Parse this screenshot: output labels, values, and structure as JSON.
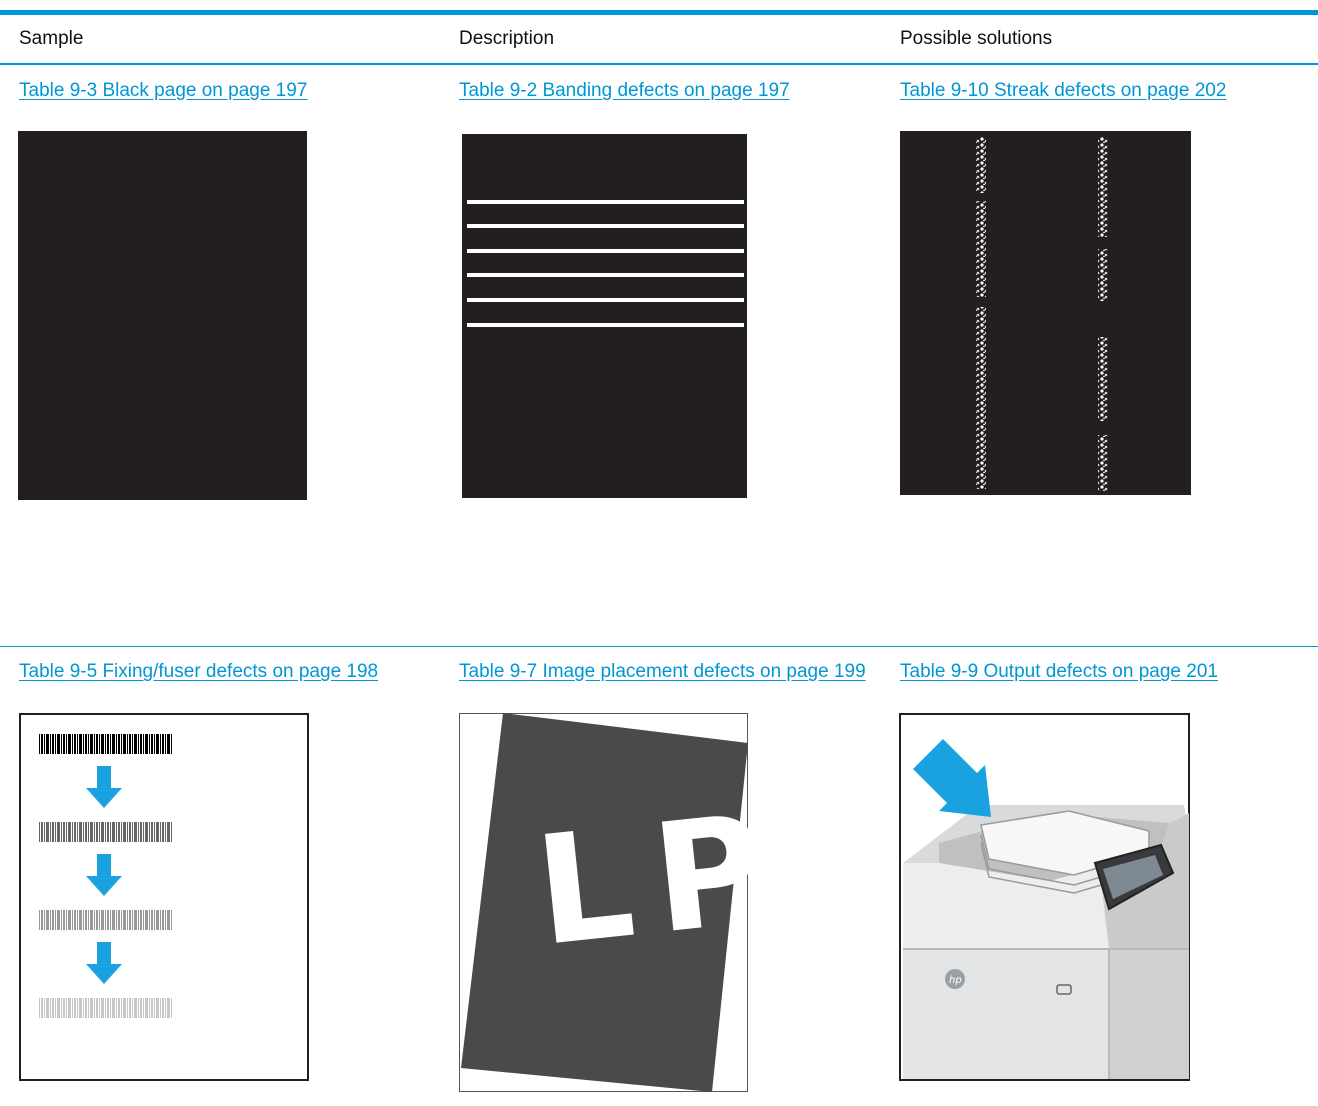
{
  "header": {
    "col_sample": "Sample",
    "col_description": "Description",
    "col_solutions": "Possible solutions"
  },
  "row1": {
    "link_black_page": "Table 9-3 Black page on page 197",
    "link_banding": "Table 9-2 Banding defects on page 197",
    "link_streak": "Table 9-10 Streak defects on page 202"
  },
  "row2": {
    "link_fixing": "Table 9-5 Fixing/fuser defects on page 198",
    "link_placement": "Table 9-7 Image placement defects on page 199",
    "link_output": "Table 9-9 Output defects on page 201",
    "placement_sample_text": "LP"
  },
  "colors": {
    "accent": "#0096d6",
    "page_black": "#231f20",
    "page_gray": "#4a4a4c",
    "arrow_blue": "#1aa1e0"
  }
}
